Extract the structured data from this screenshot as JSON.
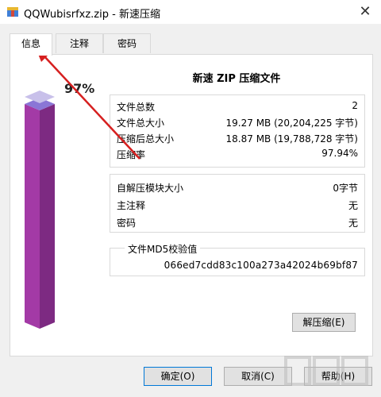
{
  "window": {
    "title": "QQWubisrfxz.zip - 新速压缩"
  },
  "tabs": [
    {
      "label": "信息"
    },
    {
      "label": "注释"
    },
    {
      "label": "密码"
    }
  ],
  "info": {
    "heading": "新速 ZIP 压缩文件",
    "ratio_display": "97%",
    "ratio_fraction": 0.97,
    "stats": [
      {
        "key": "文件总数",
        "value": "2"
      },
      {
        "key": "文件总大小",
        "value": "19.27 MB (20,204,225 字节)"
      },
      {
        "key": "压缩后总大小",
        "value": "18.87 MB (19,788,728 字节)"
      },
      {
        "key": "压缩率",
        "value": "97.94%"
      }
    ],
    "extra": [
      {
        "key": "自解压模块大小",
        "value": "0字节"
      },
      {
        "key": "主注释",
        "value": "无"
      },
      {
        "key": "密码",
        "value": "无"
      }
    ],
    "md5": {
      "legend": "文件MD5校验值",
      "value": "066ed7cdd83c100a273a42024b69bf87"
    }
  },
  "buttons": {
    "extract": "解压缩(E)",
    "ok": "确定(O)",
    "cancel": "取消(C)",
    "help": "帮助(H)"
  },
  "colors": {
    "bar_front": "#a33aa6",
    "bar_side": "#7d2a82",
    "bar_top": "#8a76d6",
    "arrow": "#d62020"
  }
}
